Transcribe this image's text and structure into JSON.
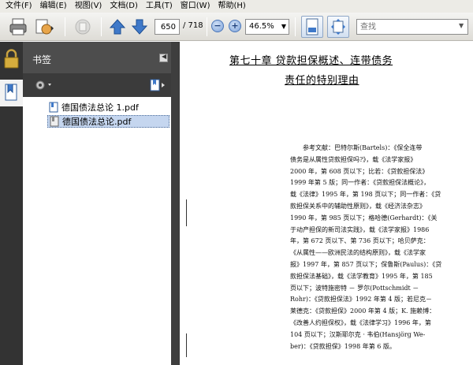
{
  "menubar": {
    "items": [
      "文件(F)",
      "编辑(E)",
      "视图(V)",
      "文档(D)",
      "工具(T)",
      "窗口(W)",
      "帮助(H)"
    ]
  },
  "toolbar": {
    "current_page": "650",
    "total_pages": "/ 718",
    "zoom": "46.5%",
    "search_placeholder": "查找"
  },
  "nav_panel": {
    "title": "书签",
    "bookmarks": [
      {
        "label": "德国债法总论 1.pdf",
        "selected": false
      },
      {
        "label": "德国债法总论.pdf",
        "selected": true
      }
    ]
  },
  "document": {
    "heading_line1": "第七十章   贷款担保概述、连带债务",
    "heading_line2": "责任的特别理由",
    "references": [
      "参考文献：巴特尔斯(Bartels)：《保全连带",
      "债务是从属性贷款担保吗?》，载《法学家报》",
      "2000 年，第 608 页以下；比若：《贷款担保法》",
      "1999 年第 5 版；同一作者：《贷款担保法概论》，",
      "载《法律》1995 年，第 198 页以下；同一作者：《贷",
      "款担保关系中的辅助性原则》，载《经济法杂志》",
      "1990 年，第 985 页以下；格哈德(Gerhardt)：《关",
      "于动产担保的新司法实践》，载《法学家报》1986",
      "年，第 672 页以下、第 736 页以下；哈贝萨克：",
      "《从属性——欧洲民法的结构原则》，载《法学家",
      "报》1997 年，第 857 页以下；保鲁斯(Paulus)：《贷",
      "款担保法基础》，载《法学教育》1995 年，第 185",
      "页以下；波特施密特 － 罗尔(Pottschmidt －",
      "Rohr)：《贷款担保法》1992 年第 4 版；若尼克－",
      "莱德克：《贷款担保》2000 年第 4 版；K. 施赖博：",
      "《改善人约担保权》，载《法律学习》1996 年，第",
      "104 页以下；汉斯耶尔克 · 韦伯(Hansjörg We-",
      "ber)：《贷款担保》1998 年第 6 版。"
    ]
  },
  "colors": {
    "nav_dark": "#333333",
    "nav_header": "#4d4d4d",
    "selection": "#c5d6ef",
    "toolbar_blue": "#4a76b8"
  }
}
